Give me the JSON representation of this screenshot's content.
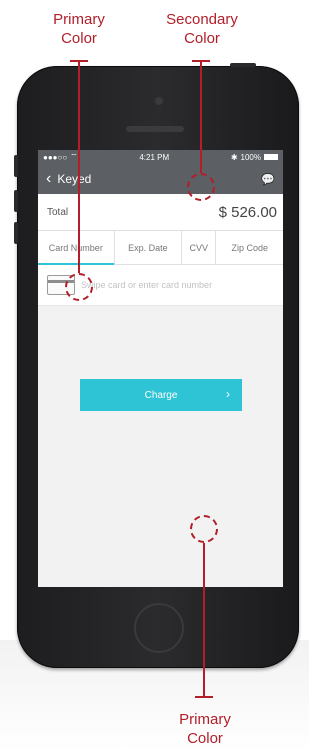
{
  "annotations": {
    "top_left": [
      "Primary",
      "Color"
    ],
    "top_right": [
      "Secondary",
      "Color"
    ],
    "bottom": [
      "Primary",
      "Color"
    ]
  },
  "status_bar": {
    "carrier": "●●●○○",
    "wifi": "⌔",
    "time": "4:21 PM",
    "bluetooth": "✱",
    "battery": "100%"
  },
  "nav": {
    "back": "‹",
    "title": "Keyed",
    "bubble": "💬"
  },
  "total": {
    "label": "Total",
    "amount": "$ 526.00"
  },
  "tabs": [
    {
      "label": "Card Number"
    },
    {
      "label": "Exp. Date"
    },
    {
      "label": "CVV"
    },
    {
      "label": "Zip Code"
    }
  ],
  "card_input": {
    "placeholder": "Swipe card or enter card number"
  },
  "charge_button": {
    "label": "Charge",
    "chevron": "›"
  },
  "colors": {
    "primary": "#2ec4d6",
    "secondary": "#5c5f63",
    "annotation": "#b11f2a"
  }
}
